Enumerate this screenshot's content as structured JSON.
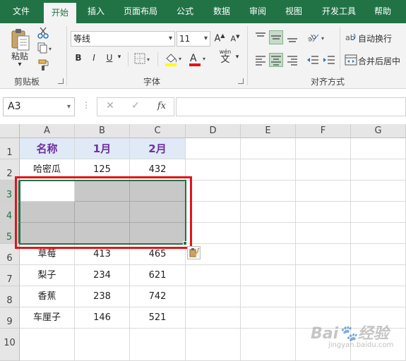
{
  "tabs": [
    {
      "id": "file",
      "label": "文件"
    },
    {
      "id": "home",
      "label": "开始"
    },
    {
      "id": "insert",
      "label": "插入"
    },
    {
      "id": "layout",
      "label": "页面布局"
    },
    {
      "id": "formula",
      "label": "公式"
    },
    {
      "id": "data",
      "label": "数据"
    },
    {
      "id": "review",
      "label": "审阅"
    },
    {
      "id": "view",
      "label": "视图"
    },
    {
      "id": "dev",
      "label": "开发工具"
    },
    {
      "id": "help",
      "label": "帮助"
    }
  ],
  "ribbon": {
    "clipboard": {
      "paste_label": "粘贴",
      "group_label": "剪贴板"
    },
    "font": {
      "font_name": "等线",
      "font_size": "11",
      "grow": "A",
      "shrink": "A",
      "bold": "B",
      "italic": "I",
      "underline": "U",
      "pinyin": "wén",
      "pinyin_char": "文",
      "font_color_letter": "A",
      "group_label": "字体"
    },
    "alignment": {
      "wrap_label": "自动换行",
      "merge_label": "合并后居中",
      "group_label": "对齐方式"
    }
  },
  "formula_bar": {
    "name_box": "A3",
    "fx": "fx",
    "cancel": "✕",
    "enter": "✓",
    "formula": ""
  },
  "grid": {
    "columns": [
      "A",
      "B",
      "C",
      "D",
      "E",
      "F",
      "G"
    ],
    "rows": [
      "1",
      "2",
      "3",
      "4",
      "5",
      "6",
      "7",
      "8",
      "9",
      "10"
    ],
    "cells": {
      "A1": "名称",
      "B1": "1月",
      "C1": "2月",
      "A2": "哈密瓜",
      "B2": "125",
      "C2": "432",
      "A6": "草莓",
      "B6": "413",
      "C6": "465",
      "A7": "梨子",
      "B7": "234",
      "C7": "621",
      "A8": "香蕉",
      "B8": "238",
      "C8": "742",
      "A9": "车厘子",
      "B9": "146",
      "C9": "521"
    }
  },
  "watermark": {
    "brand": "Bai",
    "brand2": "经验",
    "url": "jingyan.baidu.com"
  },
  "colors": {
    "accent": "#217346",
    "header_fill": "#dfeaf6",
    "header_text": "#7030a0",
    "selection_fill": "#c8c8c8",
    "highlight_box": "#e3141b"
  }
}
